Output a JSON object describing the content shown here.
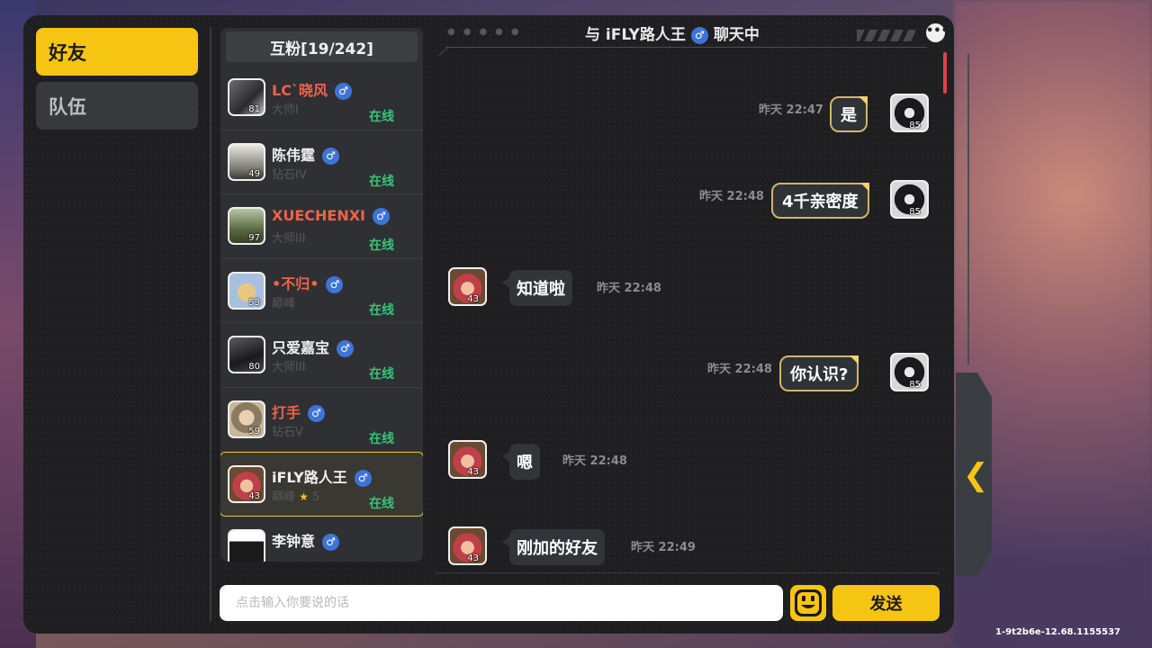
{
  "tabs": {
    "friends": "好友",
    "team": "队伍"
  },
  "friend_list": {
    "header": "互粉[19/242]",
    "friends": [
      {
        "name": "LC`晓风",
        "gender": "♂",
        "rank": "大师I",
        "status": "在线",
        "level": "81"
      },
      {
        "name": "陈伟霆",
        "gender": "♂",
        "rank": "钻石IV",
        "status": "在线",
        "level": "49"
      },
      {
        "name": "XUECHENXI",
        "gender": "♂",
        "rank": "大师III",
        "status": "在线",
        "level": "97"
      },
      {
        "name": "•不归•",
        "gender": "♂",
        "rank": "巅峰",
        "status": "在线",
        "level": "53"
      },
      {
        "name": "只爱嘉宝",
        "gender": "♂",
        "rank": "大师III",
        "status": "在线",
        "level": "80"
      },
      {
        "name": "打手",
        "gender": "♂",
        "rank": "钻石V",
        "status": "在线",
        "level": "59"
      },
      {
        "name": "iFLY路人王",
        "gender": "♂",
        "rank": "巅峰",
        "rank_stars": "5",
        "status": "在线",
        "level": "43"
      },
      {
        "name": "李钟意",
        "gender": "♂",
        "level": ""
      }
    ]
  },
  "chat": {
    "title_prefix": "与",
    "partner": "iFLY路人王",
    "partner_gender": "♂",
    "title_suffix": "聊天中",
    "more_icon": "•••",
    "messages": [
      {
        "from": "me",
        "text": "是",
        "time": "昨天 22:47",
        "level": "85"
      },
      {
        "from": "me",
        "text": "4千亲密度",
        "time": "昨天 22:48",
        "level": "85"
      },
      {
        "from": "them",
        "text": "知道啦",
        "time": "昨天 22:48",
        "level": "43"
      },
      {
        "from": "me",
        "text": "你认识?",
        "time": "昨天 22:48",
        "level": "85"
      },
      {
        "from": "them",
        "text": "嗯",
        "time": "昨天 22:48",
        "level": "43"
      },
      {
        "from": "them",
        "text": "刚加的好友",
        "time": "昨天 22:49",
        "level": "43"
      }
    ]
  },
  "composer": {
    "placeholder": "点击输入你要说的话",
    "send_label": "发送"
  },
  "side_arrow": "❮",
  "version": "1-9t2b6e-12.68.1155537",
  "colors": {
    "accent": "#f6c514",
    "online": "#36c47a",
    "highlight_name": "#f0624a",
    "gender": "#3e74d8"
  }
}
